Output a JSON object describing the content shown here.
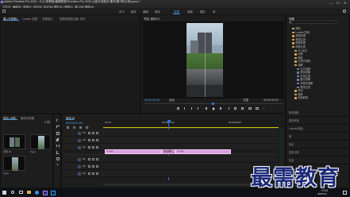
{
  "window": {
    "title": "Adobe Premiere Pro 2020 - E:\\小学教程\\最需教育\\Premiere Pro 2020 从新手到高手\\素材\\第4章\\示例.prproj *",
    "min": "—",
    "max": "☐",
    "close": "✕"
  },
  "menu": [
    "文件(F)",
    "编辑(E)",
    "剪辑(C)",
    "序列(S)",
    "标记(M)",
    "图形(G)",
    "视图(V)",
    "窗口(W)",
    "帮助(H)"
  ],
  "workspaces": [
    "学习",
    "组件",
    "编辑",
    "颜色",
    "效果",
    "音频",
    "图形",
    "库"
  ],
  "active_workspace": "效果",
  "source": {
    "tabs": [
      "源: (无剪辑)",
      "Lumetri 范围",
      "效果控件",
      "音频剪辑混合器: 序列"
    ],
    "active_tab": 0
  },
  "program": {
    "tab": "节目: 序列 01",
    "timecode_left": "00;00;02;26",
    "fit": "适合",
    "quality": "完整",
    "timecode_right": "00;00;05;00"
  },
  "effects": {
    "tab": "效果",
    "items": [
      {
        "label": "预设",
        "level": 0
      },
      {
        "label": "Lumetri 预设",
        "level": 0
      },
      {
        "label": "音频效果",
        "level": 0
      },
      {
        "label": "音频过渡",
        "level": 0
      },
      {
        "label": "视频效果",
        "level": 0
      },
      {
        "label": "视频过渡",
        "level": 0
      },
      {
        "label": "3D 运动",
        "level": 1
      },
      {
        "label": "划像",
        "level": 1
      },
      {
        "label": "擦除",
        "level": 1
      },
      {
        "label": "沉浸式视频",
        "level": 1
      },
      {
        "label": "溶解",
        "level": 1
      },
      {
        "label": "交叉溶解",
        "level": 2
      },
      {
        "label": "叠加溶解",
        "level": 2
      },
      {
        "label": "白场过渡",
        "level": 2
      },
      {
        "label": "胶片溶解",
        "level": 2
      },
      {
        "label": "非叠加溶解",
        "level": 2
      },
      {
        "label": "黑场过渡",
        "level": 2
      },
      {
        "label": "滑动",
        "level": 1
      },
      {
        "label": "缩放",
        "level": 1
      },
      {
        "label": "页面剥落",
        "level": 1
      }
    ],
    "lower_panels": [
      "基本图形",
      "基本声音",
      "Lumetri 颜色",
      "库",
      "标记",
      "历史记录",
      "信息"
    ]
  },
  "project": {
    "tabs": [
      "项目: 示例",
      "媒体浏览器"
    ],
    "active_tab": 0,
    "item_count": "3 项",
    "clips": [
      {
        "name": "序列 01",
        "duration": "5;00"
      },
      {
        "name": "2.jpg",
        "duration": "5;00"
      },
      {
        "name": "1.jpg",
        "duration": "5;00"
      }
    ]
  },
  "timeline": {
    "tab": "序列 01",
    "timecode": "00;00;02;26",
    "ruler": [
      "00;00",
      "00;00;04;00",
      "00;00;08;00"
    ],
    "tracks": [
      "V3",
      "V2",
      "V1",
      "A1",
      "A2",
      "A3"
    ],
    "clips": [
      {
        "label": "fx 1.jpg",
        "track": "V1"
      },
      {
        "label": "交叉溶解",
        "track": "V1"
      },
      {
        "label": "fx 2.jpg",
        "track": "V1"
      }
    ]
  },
  "taskbar": {
    "time": "17:03",
    "date": "2020/1/4"
  },
  "watermark": "最需教育",
  "colors": {
    "accent": "#4b9ff0",
    "clip": "#d9a1e0",
    "transition": "#c789c4",
    "playhead": "#2f74d6",
    "work_area": "#c9c100"
  }
}
